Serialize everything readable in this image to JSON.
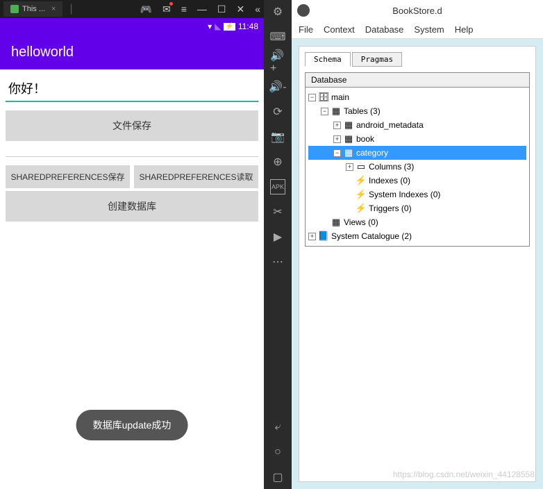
{
  "titlebar": {
    "tab_label": "This ..."
  },
  "statusbar": {
    "time": "11:48"
  },
  "appbar": {
    "title": "helloworld"
  },
  "app": {
    "input_value": "你好！",
    "btn_file_save": "文件保存",
    "btn_sp_save": "SHAREDPREFERENCES保存",
    "btn_sp_load": "SHAREDPREFERENCES读取",
    "btn_create_db": "创建数据库",
    "toast": "数据库update成功"
  },
  "db": {
    "title": "BookStore.d",
    "menus": [
      "File",
      "Context",
      "Database",
      "System",
      "Help"
    ],
    "tabs": [
      "Schema",
      "Pragmas"
    ],
    "tree_header": "Database",
    "nodes": {
      "main": "main",
      "tables": "Tables (3)",
      "android_metadata": "android_metadata",
      "book": "book",
      "category": "category",
      "columns": "Columns (3)",
      "indexes": "Indexes (0)",
      "system_indexes": "System Indexes (0)",
      "triggers": "Triggers (0)",
      "views": "Views (0)",
      "system_catalogue": "System Catalogue (2)"
    }
  },
  "watermark": "https://blog.csdn.net/weixin_44128558"
}
